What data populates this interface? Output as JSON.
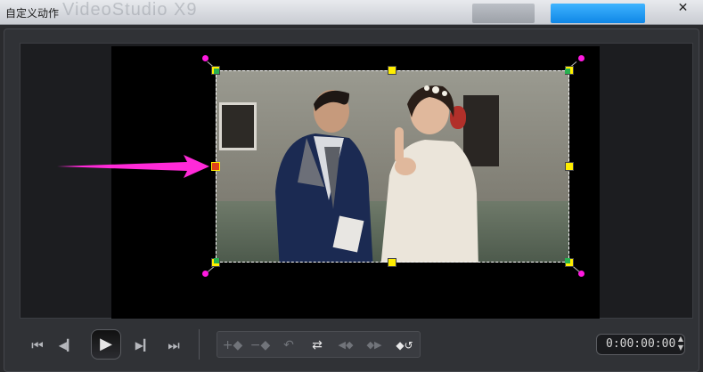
{
  "window": {
    "title": "自定义动作",
    "brand_watermark": "VideoStudio X9",
    "close_glyph": "✕"
  },
  "colors": {
    "accent_tab": "#1a95f0",
    "handle_yellow": "#ffee00",
    "handle_red": "#e0401a",
    "rotate_dot_magenta": "#ff1ae0",
    "annotation_arrow": "#ff2ad8"
  },
  "playback": {
    "buttons": [
      {
        "name": "go-to-start",
        "glyph": "⏮"
      },
      {
        "name": "previous-frame",
        "glyph": "◀▎"
      },
      {
        "name": "play",
        "glyph": "▶"
      },
      {
        "name": "next-frame",
        "glyph": "▶▎"
      },
      {
        "name": "go-to-end",
        "glyph": "⏭"
      }
    ]
  },
  "keyframe_tools": {
    "buttons": [
      {
        "name": "add-keyframe",
        "glyph": "+◆",
        "active": false
      },
      {
        "name": "remove-keyframe",
        "glyph": "−◆",
        "active": false
      },
      {
        "name": "reverse-keyframe",
        "glyph": "↶",
        "active": false
      },
      {
        "name": "swap-keyframes",
        "glyph": "⇄",
        "active": true
      },
      {
        "name": "prev-keyframe",
        "glyph": "◀◆",
        "active": false
      },
      {
        "name": "next-keyframe",
        "glyph": "◆▶",
        "active": false
      },
      {
        "name": "reset-keyframe",
        "glyph": "◆↺",
        "active": true
      }
    ]
  },
  "timecode": {
    "value": "0:00:00:00",
    "spin_up": "▲",
    "spin_down": "▼"
  }
}
